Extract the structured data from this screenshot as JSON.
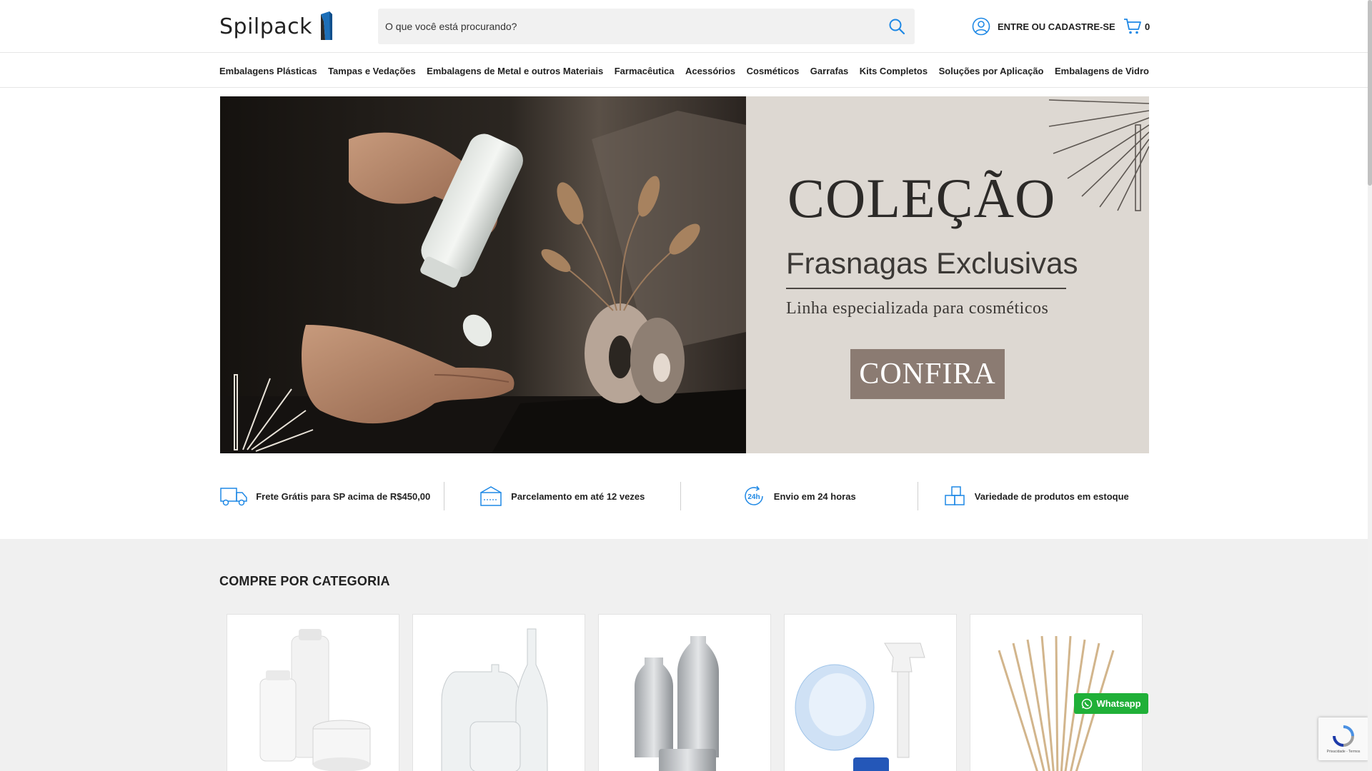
{
  "brand": {
    "name": "Spilpack"
  },
  "search": {
    "placeholder": "O que você está procurando?"
  },
  "account": {
    "label": "ENTRE OU CADASTRE-SE"
  },
  "cart": {
    "count": "0"
  },
  "nav": {
    "items": [
      {
        "label": "Embalagens Plásticas"
      },
      {
        "label": "Tampas e Vedações"
      },
      {
        "label": "Embalagens de Metal e outros Materiais"
      },
      {
        "label": "Farmacêutica"
      },
      {
        "label": "Acessórios"
      },
      {
        "label": "Cosméticos"
      },
      {
        "label": "Garrafas"
      },
      {
        "label": "Kits Completos"
      },
      {
        "label": "Soluções por Aplicação"
      },
      {
        "label": "Embalagens de Vidro"
      }
    ]
  },
  "hero": {
    "title": "COLEÇÃO",
    "subtitle": "Frasnagas Exclusivas",
    "tagline": "Linha especializada para cosméticos",
    "cta": "CONFIRA"
  },
  "benefits": [
    {
      "text": "Frete Grátis para SP acima de R$450,00",
      "icon": "truck-icon"
    },
    {
      "text": "Parcelamento em até 12 vezes",
      "icon": "card-icon"
    },
    {
      "text": "Envio em 24 horas",
      "icon": "clock-24h-icon",
      "badge": "24h"
    },
    {
      "text": "Variedade de produtos em estoque",
      "icon": "boxes-icon"
    }
  ],
  "categories": {
    "title": "COMPRE POR CATEGORIA",
    "items": [
      {
        "name": "plastic-packaging"
      },
      {
        "name": "glass-packaging"
      },
      {
        "name": "metal-packaging"
      },
      {
        "name": "caps-and-sprayers"
      },
      {
        "name": "accessories-reed-sticks"
      }
    ]
  },
  "whatsapp": {
    "label": "Whatsapp"
  },
  "recaptcha": {
    "text": "Privacidade - Termos"
  },
  "colors": {
    "accent": "#1e88e5",
    "cta": "#8b7b72",
    "whatsapp": "#20b038"
  }
}
